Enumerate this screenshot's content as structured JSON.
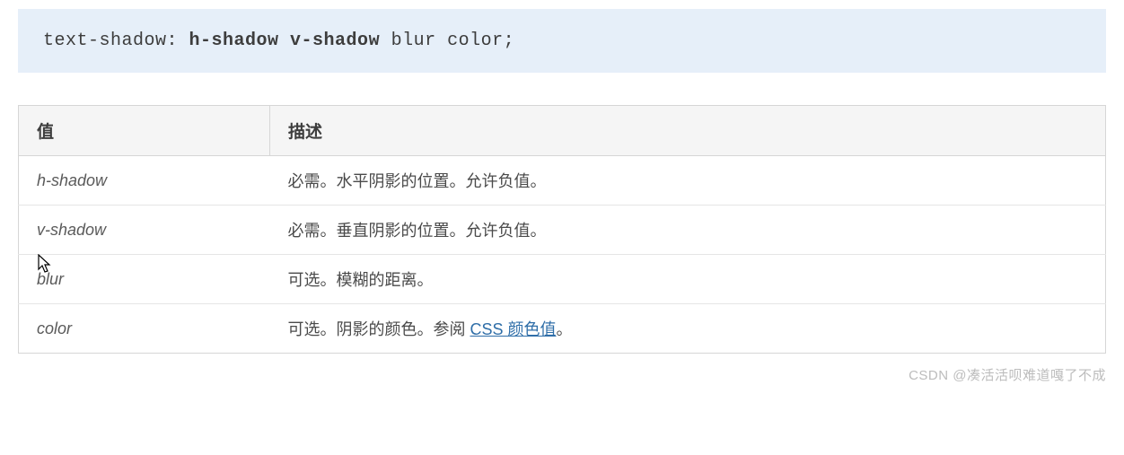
{
  "code": {
    "prefix": "text-shadow: ",
    "bold": "h-shadow v-shadow",
    "suffix": " blur color;"
  },
  "table": {
    "headers": {
      "value": "值",
      "description": "描述"
    },
    "rows": [
      {
        "value": "h-shadow",
        "desc": "必需。水平阴影的位置。允许负值。"
      },
      {
        "value": "v-shadow",
        "desc": "必需。垂直阴影的位置。允许负值。"
      },
      {
        "value": "blur",
        "desc": "可选。模糊的距离。"
      },
      {
        "value": "color",
        "desc_prefix": "可选。阴影的颜色。参阅 ",
        "link_text": "CSS 颜色值",
        "desc_suffix": "。"
      }
    ]
  },
  "watermark": "CSDN @凑活活呗难道嘎了不成"
}
